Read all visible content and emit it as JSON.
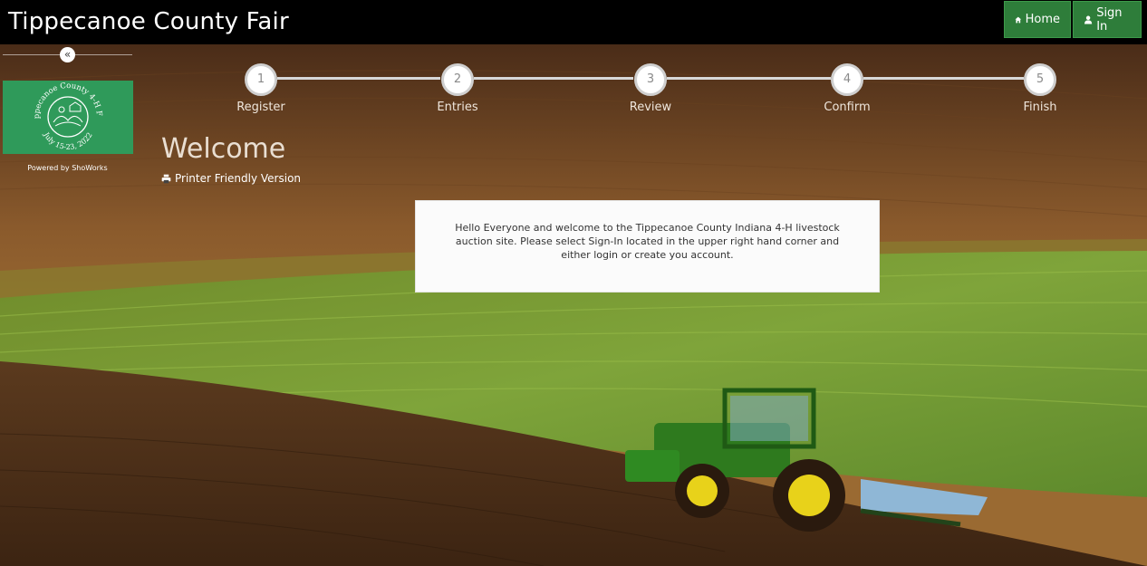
{
  "header": {
    "brand": "Tippecanoe County Fair",
    "home_label": "Home",
    "signin_label": "Sign In",
    "home_icon": "home-icon",
    "signin_icon": "user-icon"
  },
  "sidebar": {
    "collapse_glyph": "«",
    "logo": {
      "text_top": "Tippecanoe County 4-H Fair",
      "text_bottom": "July 15-23, 2022"
    },
    "powered_by": "Powered by ShoWorks"
  },
  "steps": [
    {
      "number": "1",
      "label": "Register"
    },
    {
      "number": "2",
      "label": "Entries"
    },
    {
      "number": "3",
      "label": "Review"
    },
    {
      "number": "4",
      "label": "Confirm"
    },
    {
      "number": "5",
      "label": "Finish"
    }
  ],
  "main": {
    "title": "Welcome",
    "printer_label": "Printer Friendly Version",
    "printer_icon": "printer-icon",
    "message": "Hello Everyone and welcome to the Tippecanoe County Indiana 4-H livestock auction site.  Please select Sign-In located in the upper right hand corner and either login or create you account."
  },
  "colors": {
    "topbar": "#000000",
    "nav_button": "#2e7d3a",
    "logo_bg": "#2f9a5a"
  }
}
